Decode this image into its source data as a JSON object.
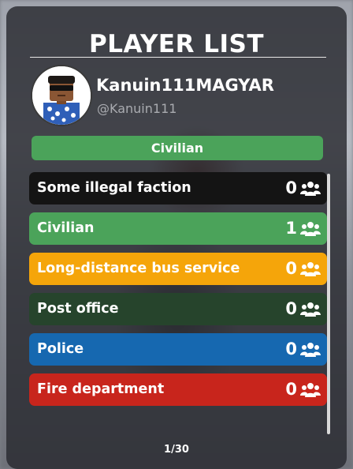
{
  "panel": {
    "title": "PLAYER LIST",
    "page_indicator": "1/30"
  },
  "player": {
    "display_name": "Kanuin111MAGYAR",
    "handle": "@Kanuin111",
    "team_badge": "Civilian",
    "team_badge_color": "#4ba35a"
  },
  "teams": [
    {
      "name": "Some illegal faction",
      "count": "0",
      "color": "#141414"
    },
    {
      "name": "Civilian",
      "count": "1",
      "color": "#4ba35a"
    },
    {
      "name": "Long-distance bus service",
      "count": "0",
      "color": "#f5a50a"
    },
    {
      "name": "Post office",
      "count": "0",
      "color": "#26442c"
    },
    {
      "name": "Police",
      "count": "0",
      "color": "#1668b0"
    },
    {
      "name": "Fire department",
      "count": "0",
      "color": "#c8251c"
    }
  ],
  "icons": {
    "team_members": "people-group-icon"
  }
}
